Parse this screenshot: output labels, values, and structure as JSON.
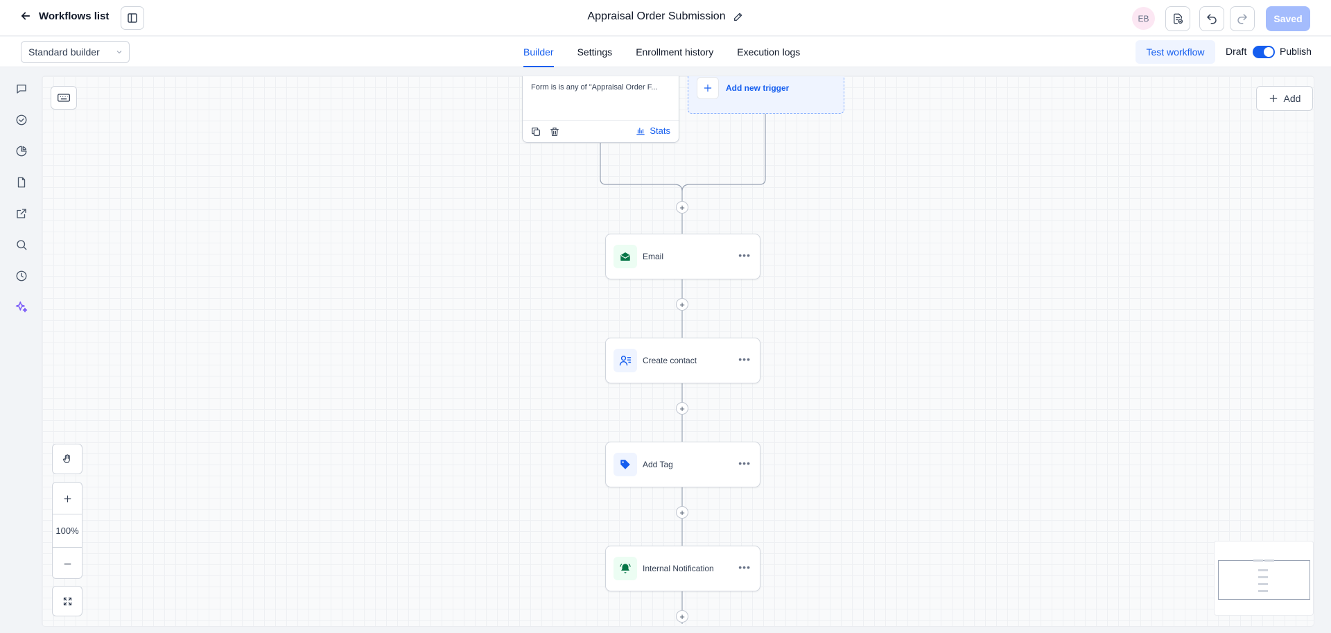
{
  "header": {
    "back_label": "Workflows list",
    "title": "Appraisal Order Submission",
    "avatar_initials": "EB",
    "saved_label": "Saved"
  },
  "subheader": {
    "builder_select_value": "Standard builder",
    "tabs": [
      {
        "label": "Builder",
        "active": true
      },
      {
        "label": "Settings",
        "active": false
      },
      {
        "label": "Enrollment history",
        "active": false
      },
      {
        "label": "Execution logs",
        "active": false
      }
    ],
    "test_label": "Test workflow",
    "draft_label": "Draft",
    "publish_label": "Publish",
    "publish_toggle_on": true
  },
  "canvas": {
    "add_label": "Add",
    "trigger": {
      "condition": "Form is is any of \"Appraisal Order F...",
      "stats_label": "Stats"
    },
    "new_trigger_label": "Add new trigger",
    "nodes": [
      {
        "label": "Email",
        "icon": "email-open-icon",
        "icon_bg": "#ecfdf3",
        "icon_color": "#067647"
      },
      {
        "label": "Create contact",
        "icon": "contact-list-icon",
        "icon_bg": "#eff4ff",
        "icon_color": "#155eef"
      },
      {
        "label": "Add Tag",
        "icon": "tag-icon",
        "icon_bg": "#eff4ff",
        "icon_color": "#155eef"
      },
      {
        "label": "Internal Notification",
        "icon": "bell-ring-icon",
        "icon_bg": "#ecfdf3",
        "icon_color": "#067647"
      }
    ],
    "zoom_level": "100%"
  },
  "colors": {
    "accent": "#155eef",
    "accent_light": "#eff4ff",
    "saved_disabled": "#a4bcfd",
    "ai_rail_icon": "#7a5af8"
  }
}
